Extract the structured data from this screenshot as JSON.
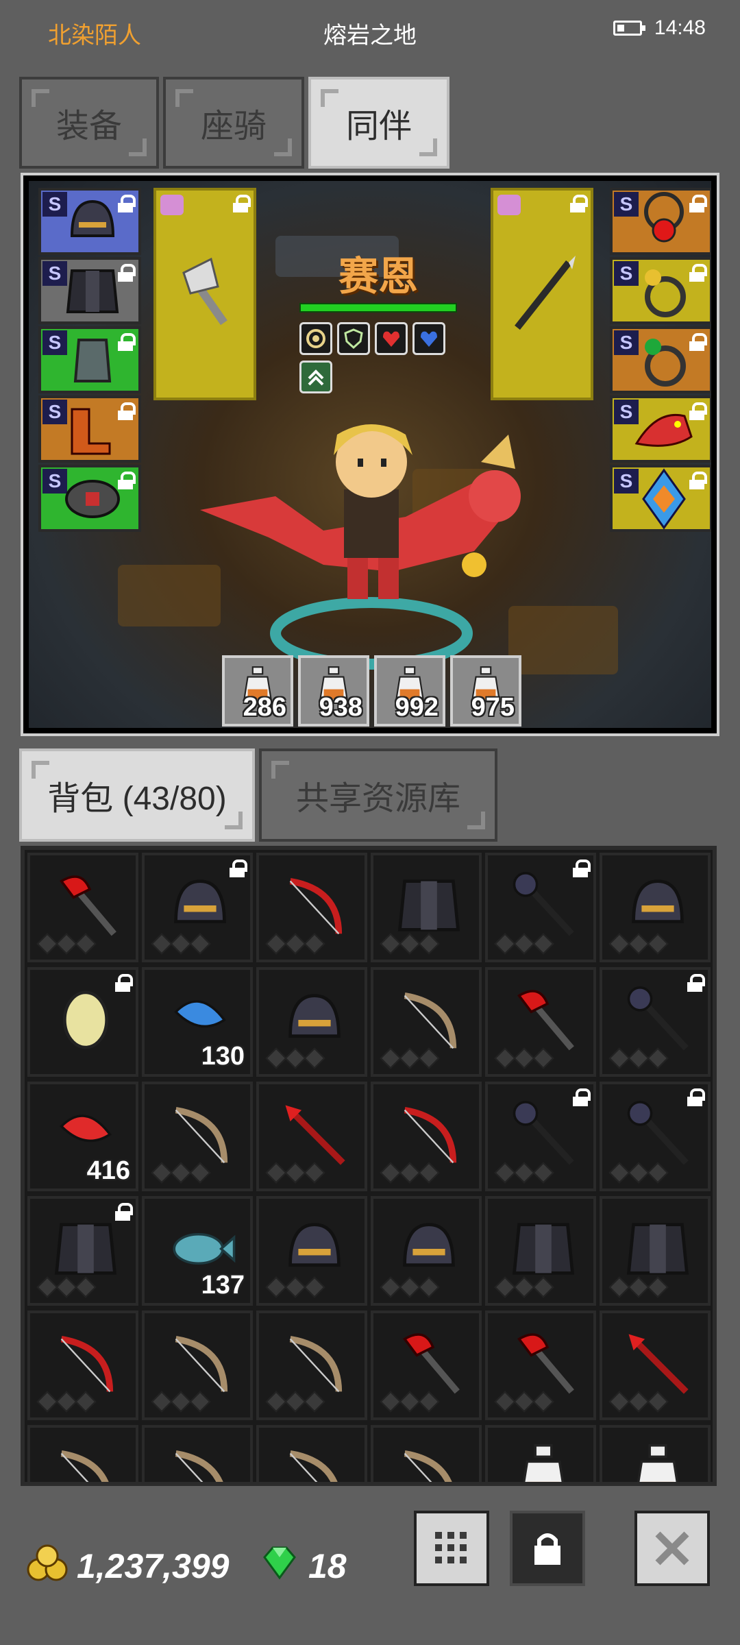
{
  "status": {
    "player_name": "北染陌人",
    "map_name": "熔岩之地",
    "time": "14:48"
  },
  "top_tabs": [
    "装备",
    "座骑",
    "同伴"
  ],
  "active_top_tab": "同伴",
  "hero": {
    "name": "赛恩",
    "hp_fraction": 1.0,
    "buff_icons": [
      "swirl-icon",
      "shield-icon",
      "heart-icon",
      "blue-heart-icon",
      "rank-up-icon"
    ]
  },
  "equipment_grade": "S",
  "left_equipment": [
    {
      "name": "helmet-icon",
      "rarity": "blue"
    },
    {
      "name": "armor-icon",
      "rarity": "gray"
    },
    {
      "name": "gauntlet-icon",
      "rarity": "green"
    },
    {
      "name": "boots-icon",
      "rarity": "orange"
    },
    {
      "name": "belt-icon",
      "rarity": "green"
    }
  ],
  "right_equipment": [
    {
      "name": "necklace-icon",
      "rarity": "orange"
    },
    {
      "name": "ring-icon",
      "rarity": "yellow"
    },
    {
      "name": "emerald-ring-icon",
      "rarity": "orange"
    },
    {
      "name": "dragon-pet-icon",
      "rarity": "yellow"
    },
    {
      "name": "crystal-icon",
      "rarity": "yellow"
    }
  ],
  "weapon_slots": [
    "axe-icon",
    "spear-icon"
  ],
  "potions": [
    {
      "count": "286"
    },
    {
      "count": "938"
    },
    {
      "count": "992"
    },
    {
      "count": "975"
    }
  ],
  "inventory_tabs": [
    "背包 (43/80)",
    "共享资源库"
  ],
  "active_inventory_tab": "背包 (43/80)",
  "inventory": [
    {
      "icon": "scythe-icon",
      "rarity": "gray",
      "locked": false,
      "count": ""
    },
    {
      "icon": "iron-helmet-icon",
      "rarity": "green",
      "locked": true,
      "count": ""
    },
    {
      "icon": "bow-icon",
      "rarity": "gray",
      "locked": false,
      "count": ""
    },
    {
      "icon": "chainmail-icon",
      "rarity": "blue",
      "locked": false,
      "count": ""
    },
    {
      "icon": "mace-icon",
      "rarity": "green",
      "locked": true,
      "count": ""
    },
    {
      "icon": "horned-helmet-icon",
      "rarity": "blue",
      "locked": false,
      "count": ""
    },
    {
      "icon": "egg-icon",
      "rarity": "orange",
      "locked": true,
      "count": ""
    },
    {
      "icon": "blue-feather-icon",
      "rarity": "light",
      "locked": false,
      "count": "130"
    },
    {
      "icon": "horned-helmet-icon",
      "rarity": "blue",
      "locked": false,
      "count": ""
    },
    {
      "icon": "wooden-bow-icon",
      "rarity": "gray",
      "locked": false,
      "count": ""
    },
    {
      "icon": "red-axe-icon",
      "rarity": "gray",
      "locked": false,
      "count": ""
    },
    {
      "icon": "mace-icon",
      "rarity": "green",
      "locked": true,
      "count": ""
    },
    {
      "icon": "red-feather-icon",
      "rarity": "light",
      "locked": false,
      "count": "416"
    },
    {
      "icon": "wooden-bow-icon",
      "rarity": "gray",
      "locked": false,
      "count": ""
    },
    {
      "icon": "red-spear-icon",
      "rarity": "gray",
      "locked": false,
      "count": ""
    },
    {
      "icon": "bow-icon",
      "rarity": "gray",
      "locked": false,
      "count": ""
    },
    {
      "icon": "mace-icon",
      "rarity": "green",
      "locked": true,
      "count": ""
    },
    {
      "icon": "mace-icon",
      "rarity": "green",
      "locked": true,
      "count": ""
    },
    {
      "icon": "dark-armor-icon",
      "rarity": "green",
      "locked": true,
      "count": ""
    },
    {
      "icon": "fish-icon",
      "rarity": "light",
      "locked": false,
      "count": "137"
    },
    {
      "icon": "horned-helmet-icon",
      "rarity": "blue",
      "locked": false,
      "count": ""
    },
    {
      "icon": "horned-helmet-icon",
      "rarity": "blue",
      "locked": false,
      "count": ""
    },
    {
      "icon": "chainmail-icon",
      "rarity": "blue",
      "locked": false,
      "count": ""
    },
    {
      "icon": "dark-armor-icon",
      "rarity": "blue",
      "locked": false,
      "count": ""
    },
    {
      "icon": "bow-icon",
      "rarity": "gray",
      "locked": false,
      "count": ""
    },
    {
      "icon": "wooden-bow-icon",
      "rarity": "gray",
      "locked": false,
      "count": ""
    },
    {
      "icon": "wooden-bow-icon",
      "rarity": "gray",
      "locked": false,
      "count": ""
    },
    {
      "icon": "red-axe-icon",
      "rarity": "gray",
      "locked": false,
      "count": ""
    },
    {
      "icon": "red-axe-icon",
      "rarity": "gray",
      "locked": false,
      "count": ""
    },
    {
      "icon": "red-spear-icon",
      "rarity": "gray",
      "locked": false,
      "count": ""
    },
    {
      "icon": "wooden-bow-icon",
      "rarity": "gray",
      "locked": false,
      "count": ""
    },
    {
      "icon": "wooden-bow-icon",
      "rarity": "gray",
      "locked": false,
      "count": ""
    },
    {
      "icon": "wooden-bow-icon",
      "rarity": "gray",
      "locked": false,
      "count": ""
    },
    {
      "icon": "wooden-bow-icon",
      "rarity": "gray",
      "locked": false,
      "count": ""
    },
    {
      "icon": "potion-icon",
      "rarity": "light",
      "locked": false,
      "count": ""
    },
    {
      "icon": "potion-icon",
      "rarity": "light",
      "locked": false,
      "count": ""
    }
  ],
  "currency": {
    "gold": "1,237,399",
    "gems": "18"
  },
  "buttons": [
    "grid-button",
    "lock-button",
    "close-button"
  ],
  "colors": {
    "blue": "#5a6bc9",
    "green": "#2fb52f",
    "orange": "#c37a25",
    "yellow": "#c3b21d",
    "gray": "#6e6e6e",
    "light": "#d8d8d8",
    "accent_name": "#f2a64a"
  }
}
